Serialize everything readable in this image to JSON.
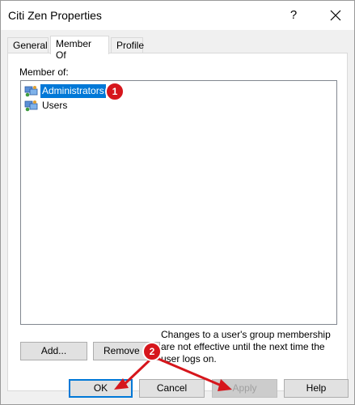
{
  "window": {
    "title": "Citi Zen Properties",
    "help_glyph": "?",
    "close_icon": "close-icon"
  },
  "tabs": [
    {
      "label": "General",
      "active": false
    },
    {
      "label": "Member Of",
      "active": true
    },
    {
      "label": "Profile",
      "active": false
    }
  ],
  "member_of": {
    "label": "Member of:",
    "items": [
      {
        "name": "Administrators",
        "icon": "group-icon",
        "selected": true
      },
      {
        "name": "Users",
        "icon": "group-icon",
        "selected": false
      }
    ]
  },
  "actions": {
    "add_label": "Add...",
    "remove_label": "Remove"
  },
  "note": "Changes to a user's group membership are not effective until the next time the user logs on.",
  "footer": {
    "ok_label": "OK",
    "cancel_label": "Cancel",
    "apply_label": "Apply",
    "help_label": "Help"
  },
  "annotations": {
    "badge1": "1",
    "badge2": "2",
    "color": "#d6161c"
  },
  "colors": {
    "selection": "#0078d7",
    "annotation": "#d6161c"
  }
}
